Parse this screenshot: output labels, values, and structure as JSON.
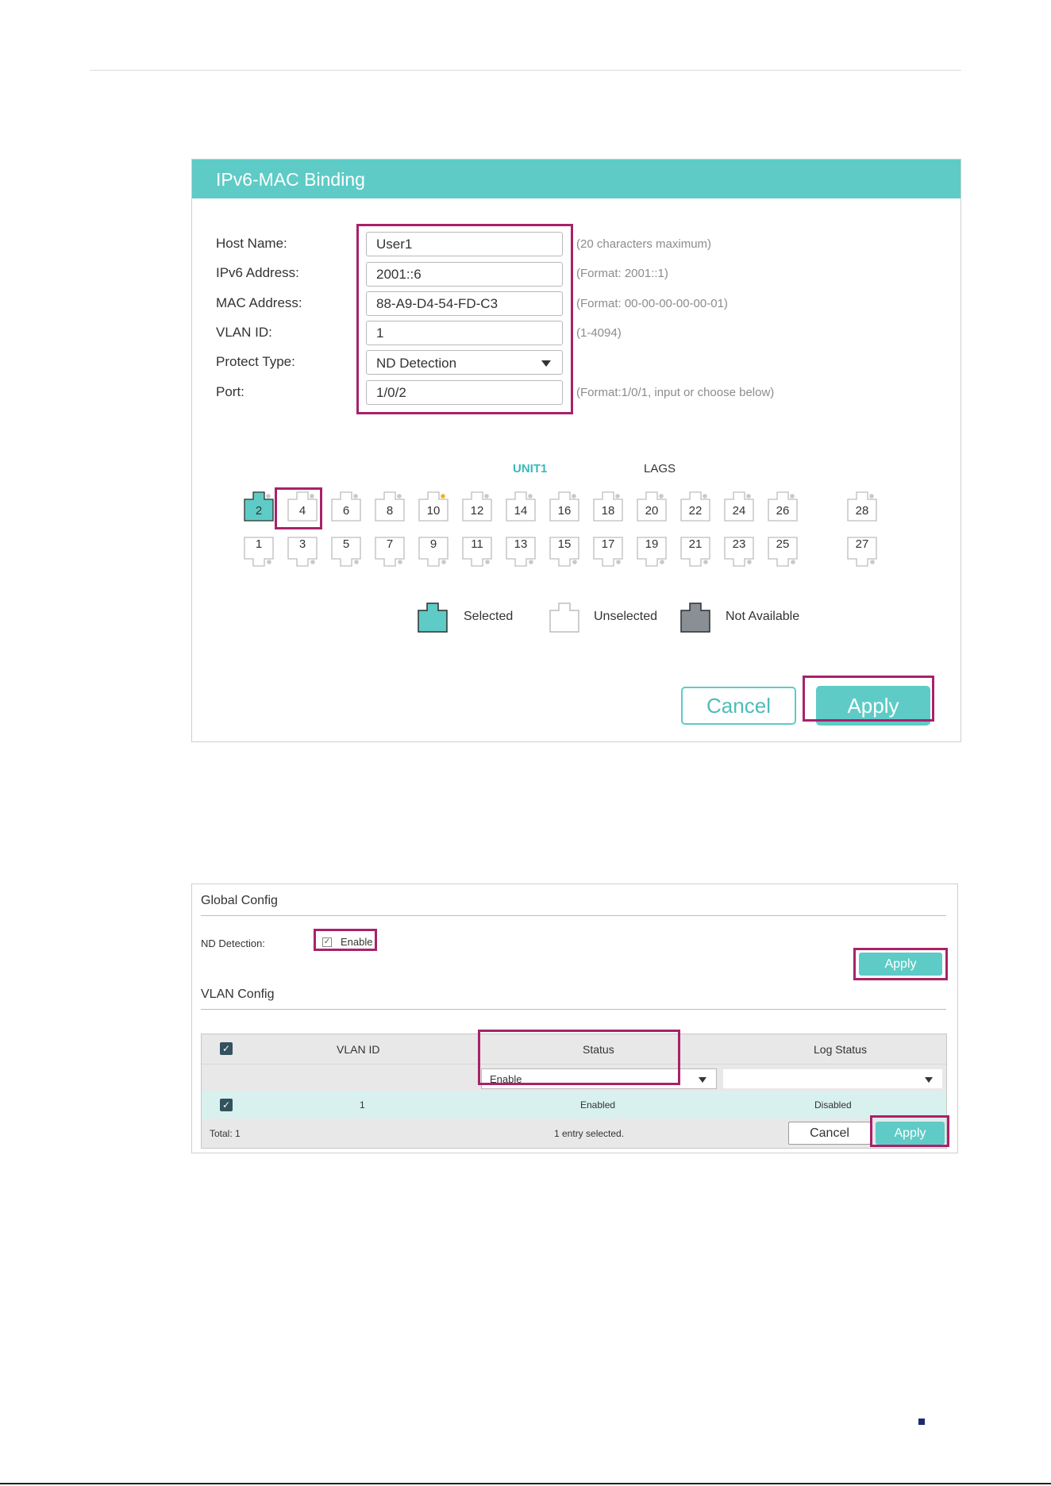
{
  "binding_panel": {
    "title": "IPv6-MAC Binding",
    "fields": {
      "host_name": {
        "label": "Host Name:",
        "value": "User1",
        "hint": "(20 characters maximum)"
      },
      "ipv6_address": {
        "label": "IPv6 Address:",
        "value": "2001::6",
        "hint": "(Format: 2001::1)"
      },
      "mac_address": {
        "label": "MAC Address:",
        "value": "88-A9-D4-54-FD-C3",
        "hint": "(Format: 00-00-00-00-00-01)"
      },
      "vlan_id": {
        "label": "VLAN ID:",
        "value": "1",
        "hint": "(1-4094)"
      },
      "protect_type": {
        "label": "Protect Type:",
        "value": "ND Detection"
      },
      "port": {
        "label": "Port:",
        "value": "1/0/2",
        "hint": "(Format:1/0/1, input or choose below)"
      }
    },
    "port_sections": {
      "unit": "UNIT1",
      "lags": "LAGS"
    },
    "ports_top": [
      "2",
      "4",
      "6",
      "8",
      "10",
      "12",
      "14",
      "16",
      "18",
      "20",
      "22",
      "24",
      "26",
      "28"
    ],
    "ports_bottom": [
      "1",
      "3",
      "5",
      "7",
      "9",
      "11",
      "13",
      "15",
      "17",
      "19",
      "21",
      "23",
      "25",
      "27"
    ],
    "selected_port": "2",
    "legend": {
      "selected": "Selected",
      "unselected": "Unselected",
      "not_available": "Not Available"
    },
    "buttons": {
      "cancel": "Cancel",
      "apply": "Apply"
    },
    "colors": {
      "accent": "#5ecbc6",
      "highlight": "#a8226a",
      "port_dot": "#f5b21d"
    }
  },
  "config_panel": {
    "global": {
      "title": "Global Config",
      "nd_detection_label": "ND Detection:",
      "enable_label": "Enable",
      "enable_checked": true,
      "apply": "Apply"
    },
    "vlan": {
      "title": "VLAN Config",
      "columns": [
        "VLAN ID",
        "Status",
        "Log Status"
      ],
      "filter_status": "Enable",
      "rows": [
        {
          "vlan_id": "1",
          "status": "Enabled",
          "log_status": "Disabled"
        }
      ],
      "total": "Total: 1",
      "selected_info": "1 entry selected.",
      "cancel": "Cancel",
      "apply": "Apply"
    }
  }
}
